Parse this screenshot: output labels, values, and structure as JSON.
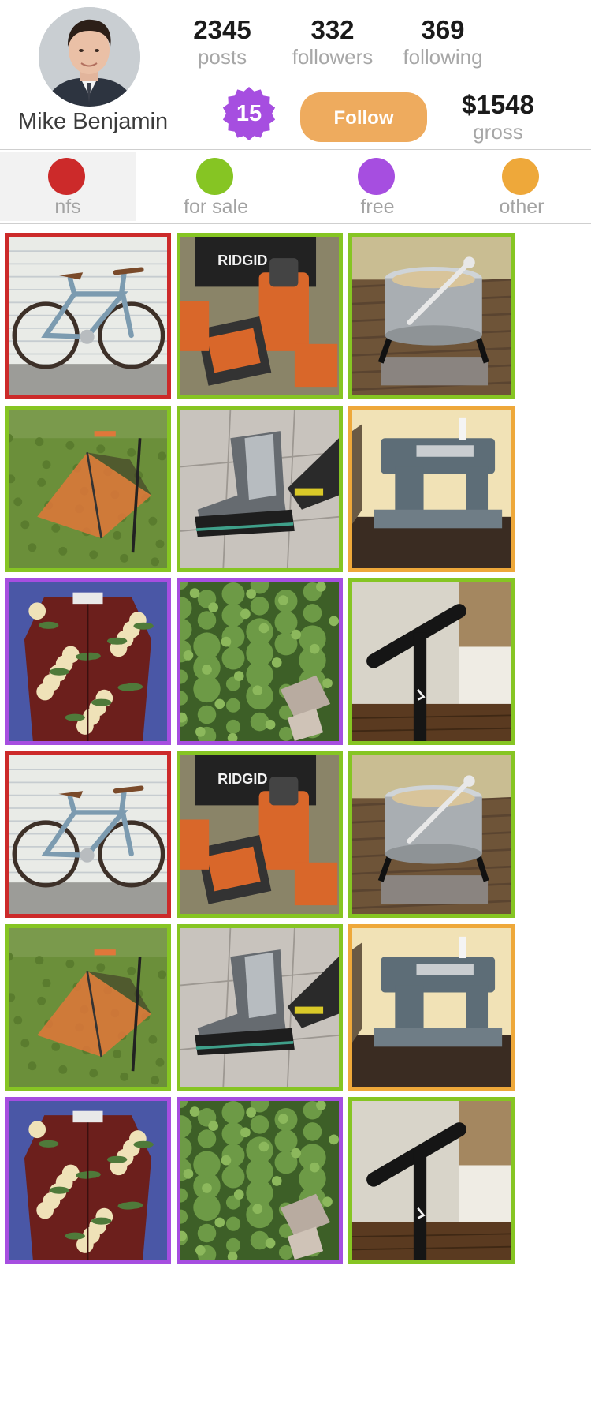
{
  "profile": {
    "name": "Mike Benjamin",
    "stats": [
      {
        "value": "2345",
        "label": "posts"
      },
      {
        "value": "332",
        "label": "followers"
      },
      {
        "value": "369",
        "label": "following"
      }
    ],
    "badge": "15",
    "follow_label": "Follow",
    "gross": {
      "value": "$1548",
      "label": "gross"
    }
  },
  "filters": [
    {
      "label": "nfs",
      "color": "#cc2a2a"
    },
    {
      "label": "for sale",
      "color": "#86c523"
    },
    {
      "label": "free",
      "color": "#a64ee0"
    },
    {
      "label": "other",
      "color": "#eea83a"
    }
  ],
  "colors": {
    "badge": "#a64ee0",
    "follow_button": "#eeab5e",
    "nfs": "#cc2a2a",
    "for_sale": "#86c523",
    "free": "#a64ee0",
    "other": "#eea83a"
  },
  "posts": [
    {
      "subject": "bicycle",
      "category": "nfs"
    },
    {
      "subject": "power-tools",
      "category": "for_sale"
    },
    {
      "subject": "stock-pot",
      "category": "for_sale"
    },
    {
      "subject": "tent",
      "category": "for_sale"
    },
    {
      "subject": "boot",
      "category": "for_sale"
    },
    {
      "subject": "sewing-machine",
      "category": "other"
    },
    {
      "subject": "hawaiian-shirt",
      "category": "free"
    },
    {
      "subject": "kale-plants",
      "category": "free"
    },
    {
      "subject": "bike-pump",
      "category": "for_sale"
    },
    {
      "subject": "bicycle",
      "category": "nfs"
    },
    {
      "subject": "power-tools",
      "category": "for_sale"
    },
    {
      "subject": "stock-pot",
      "category": "for_sale"
    },
    {
      "subject": "tent",
      "category": "for_sale"
    },
    {
      "subject": "boot",
      "category": "for_sale"
    },
    {
      "subject": "sewing-machine",
      "category": "other"
    },
    {
      "subject": "hawaiian-shirt",
      "category": "free"
    },
    {
      "subject": "kale-plants",
      "category": "free"
    },
    {
      "subject": "bike-pump",
      "category": "for_sale"
    }
  ]
}
